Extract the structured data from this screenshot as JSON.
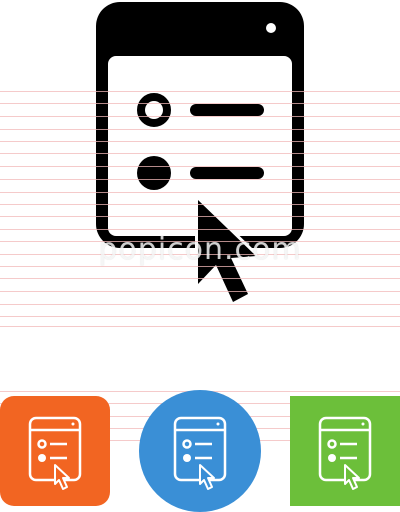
{
  "watermark": {
    "text": "popicon.com"
  },
  "icon": {
    "name": "checklist-pointer-icon",
    "color": "#000000",
    "background": "#ffffff"
  },
  "variants": [
    {
      "name": "orange-square-variant",
      "shape": "rounded-square",
      "color": "#f26522"
    },
    {
      "name": "blue-circle-variant",
      "shape": "circle",
      "color": "#3a8fd6"
    },
    {
      "name": "green-square-variant",
      "shape": "square",
      "color": "#6cbf3a"
    }
  ],
  "colors": {
    "rule_lines": "#f2b8b8"
  }
}
